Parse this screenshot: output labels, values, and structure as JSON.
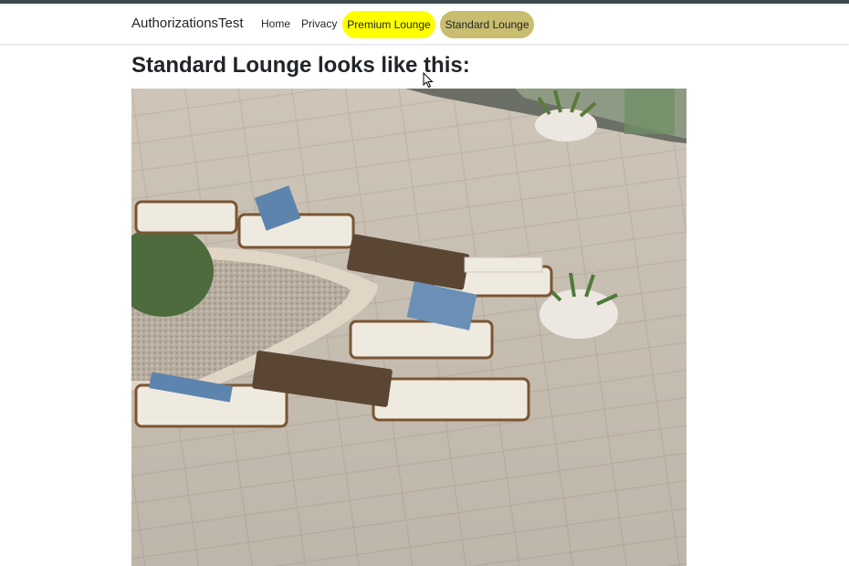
{
  "nav": {
    "brand": "AuthorizationsTest",
    "links": [
      "Home",
      "Privacy"
    ],
    "premium_label": "Premium Lounge",
    "standard_label": "Standard Lounge"
  },
  "main": {
    "heading": "Standard Lounge looks like this:",
    "image_alt": "outdoor lounge terrace with cushioned chairs and wooden tables"
  },
  "colors": {
    "premium_pill": "#ffff00",
    "standard_pill": "#c9bd6f",
    "topbar": "#3d4a4d"
  }
}
